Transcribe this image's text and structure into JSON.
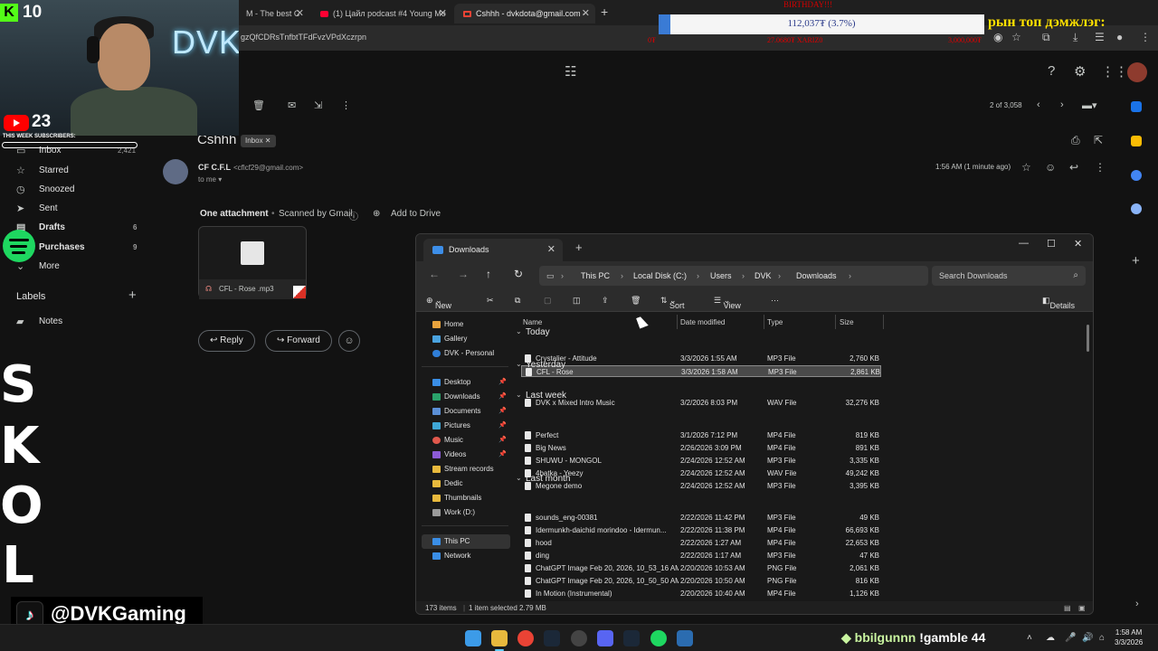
{
  "browser": {
    "tabs": [
      {
        "label": "M - The best C"
      },
      {
        "label": "(1) Цайл podcast #4 Young Mo"
      },
      {
        "label": "Cshhh - dvkdota@gmail.com -"
      }
    ],
    "url": "gzQfCDRsTnfbtTFdFvzVPdXczrpn"
  },
  "stream_overlay": {
    "birthday": "BIRTHDAY!!!",
    "goal_text": "112,037₮ (3.7%)",
    "goal_progress": 0.037,
    "sub_left": "0₮",
    "sub_mid": "27.0680₮ XARIZ0",
    "sub_right": "3,000,000₮",
    "top_donor_label": "рын топ дэмжлэг:",
    "kick_count": "10",
    "yt_count": "23",
    "subs_label": "THIS WEEK SUBSCRIBERS:",
    "tiktok_handle": "@DVKGaming",
    "neon_sign": "DVK",
    "side_glyphs": [
      "S",
      "K",
      "O",
      "L"
    ]
  },
  "gmail": {
    "pager": "2 of 3,058",
    "subject": "Cshhh",
    "inbox_chip": "Inbox",
    "sender_name": "CF C.F.L",
    "sender_email": "<cflcf29@gmail.com>",
    "to_me": "to me",
    "time": "1:56 AM (1 minute ago)",
    "attachment_heading": "One attachment",
    "scanned": "Scanned by Gmail",
    "add_to_drive": "Add to Drive",
    "attachment_name": "CFL - Rose .mp3",
    "reply": "Reply",
    "forward": "Forward",
    "nav": [
      {
        "label": "Inbox",
        "count": "2,421"
      },
      {
        "label": "Starred",
        "count": ""
      },
      {
        "label": "Snoozed",
        "count": ""
      },
      {
        "label": "Sent",
        "count": ""
      },
      {
        "label": "Drafts",
        "count": "6"
      },
      {
        "label": "Purchases",
        "count": "9"
      },
      {
        "label": "More",
        "count": ""
      }
    ],
    "labels_heading": "Labels",
    "labels": [
      {
        "label": "Notes"
      }
    ]
  },
  "explorer": {
    "tab_title": "Downloads",
    "breadcrumbs": [
      "This PC",
      "Local Disk (C:)",
      "Users",
      "DVK",
      "Downloads"
    ],
    "search_placeholder": "Search Downloads",
    "cmd": {
      "new": "New",
      "sort": "Sort",
      "view": "View",
      "more": "···",
      "details": "Details"
    },
    "sidebar": [
      {
        "label": "Home"
      },
      {
        "label": "Gallery"
      },
      {
        "label": "DVK - Personal"
      },
      {
        "label": "Desktop"
      },
      {
        "label": "Downloads"
      },
      {
        "label": "Documents"
      },
      {
        "label": "Pictures"
      },
      {
        "label": "Music"
      },
      {
        "label": "Videos"
      },
      {
        "label": "Stream records"
      },
      {
        "label": "Dedic"
      },
      {
        "label": "Thumbnails"
      },
      {
        "label": "Work (D:)"
      },
      {
        "label": "This PC"
      },
      {
        "label": "Network"
      }
    ],
    "columns": [
      "Name",
      "Date modified",
      "Type",
      "Size"
    ],
    "groups": [
      {
        "label": "Today",
        "files": [
          {
            "name": "Crystalier - Attitude",
            "date": "3/3/2026 1:55 AM",
            "type": "MP3 File",
            "size": "2,760 KB"
          },
          {
            "name": "CFL - Rose",
            "date": "3/3/2026 1:58 AM",
            "type": "MP3 File",
            "size": "2,861 KB"
          }
        ]
      },
      {
        "label": "Yesterday",
        "files": [
          {
            "name": "DVK x Mixed Intro Music",
            "date": "3/2/2026 8:03 PM",
            "type": "WAV File",
            "size": "32,276 KB"
          }
        ]
      },
      {
        "label": "Last week",
        "files": [
          {
            "name": "Perfect",
            "date": "3/1/2026 7:12 PM",
            "type": "MP4 File",
            "size": "819 KB"
          },
          {
            "name": "Big News",
            "date": "2/26/2026 3:09 PM",
            "type": "MP4 File",
            "size": "891 KB"
          },
          {
            "name": "SHUWU - MONGOL",
            "date": "2/24/2026 12:52 AM",
            "type": "MP3 File",
            "size": "3,335 KB"
          },
          {
            "name": "4batka - Yeezy",
            "date": "2/24/2026 12:52 AM",
            "type": "WAV File",
            "size": "49,242 KB"
          },
          {
            "name": "Megone demo",
            "date": "2/24/2026 12:52 AM",
            "type": "MP3 File",
            "size": "3,395 KB"
          }
        ]
      },
      {
        "label": "Last month",
        "files": [
          {
            "name": "sounds_eng-00381",
            "date": "2/22/2026 11:42 PM",
            "type": "MP3 File",
            "size": "49 KB"
          },
          {
            "name": "Idermunkh-daichid morindoo - Idermun...",
            "date": "2/22/2026 11:38 PM",
            "type": "MP4 File",
            "size": "66,693 KB"
          },
          {
            "name": "hood",
            "date": "2/22/2026 1:27 AM",
            "type": "MP4 File",
            "size": "22,653 KB"
          },
          {
            "name": "ding",
            "date": "2/22/2026 1:17 AM",
            "type": "MP3 File",
            "size": "47 KB"
          },
          {
            "name": "ChatGPT Image Feb 20, 2026, 10_53_16 AM",
            "date": "2/20/2026 10:53 AM",
            "type": "PNG File",
            "size": "2,061 KB"
          },
          {
            "name": "ChatGPT Image Feb 20, 2026, 10_50_50 AM",
            "date": "2/20/2026 10:50 AM",
            "type": "PNG File",
            "size": "816 KB"
          },
          {
            "name": "In Motion (Instrumental)",
            "date": "2/20/2026 10:40 AM",
            "type": "MP4 File",
            "size": "1,126 KB"
          }
        ]
      }
    ],
    "status_items": "173 items",
    "status_selected": "1 item selected  2.79 MB"
  },
  "taskbar": {
    "chat_name": "bbilgunnn",
    "chat_msg": "!gamble 44",
    "time": "1:58 AM",
    "date": "3/3/2026"
  }
}
